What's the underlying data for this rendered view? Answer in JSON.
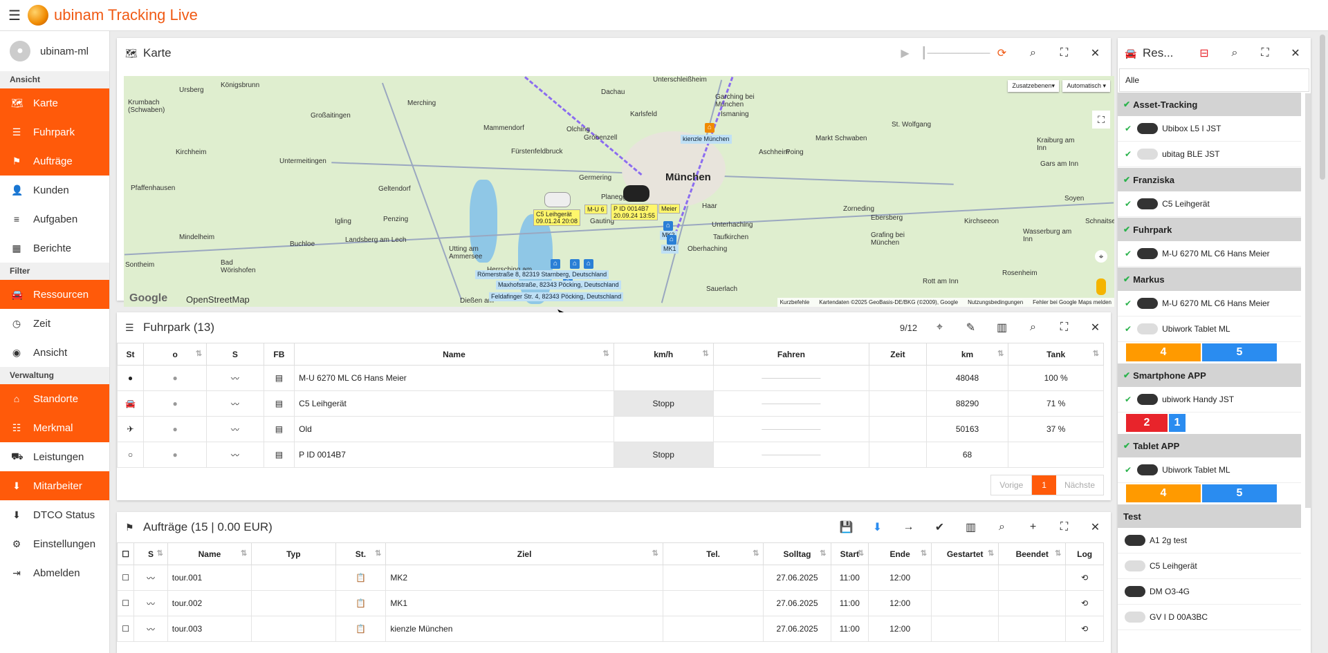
{
  "app": {
    "title": "ubinam Tracking Live"
  },
  "user": {
    "name": "ubinam-ml"
  },
  "sidebar": {
    "sections": [
      {
        "label": "Ansicht",
        "items": [
          {
            "label": "Karte",
            "icon": "map-icon",
            "active": true
          },
          {
            "label": "Fuhrpark",
            "icon": "list-icon",
            "active": true
          },
          {
            "label": "Aufträge",
            "icon": "flag-icon",
            "active": true
          },
          {
            "label": "Kunden",
            "icon": "person-icon",
            "active": false
          },
          {
            "label": "Aufgaben",
            "icon": "tasks-icon",
            "active": false
          },
          {
            "label": "Berichte",
            "icon": "table-icon",
            "active": false
          }
        ]
      },
      {
        "label": "Filter",
        "items": [
          {
            "label": "Ressourcen",
            "icon": "car-icon",
            "active": true
          },
          {
            "label": "Zeit",
            "icon": "clock-icon",
            "active": false
          },
          {
            "label": "Ansicht",
            "icon": "eye-icon",
            "active": false
          }
        ]
      },
      {
        "label": "Verwaltung",
        "items": [
          {
            "label": "Standorte",
            "icon": "home-icon",
            "active": true
          },
          {
            "label": "Merkmal",
            "icon": "sliders-icon",
            "active": true
          },
          {
            "label": "Leistungen",
            "icon": "basket-icon",
            "active": false
          },
          {
            "label": "Mitarbeiter",
            "icon": "download-icon",
            "active": true
          },
          {
            "label": "DTCO Status",
            "icon": "download-icon",
            "active": false
          },
          {
            "label": "Einstellungen",
            "icon": "gear-icon",
            "active": false
          },
          {
            "label": "Abmelden",
            "icon": "logout-icon",
            "active": false
          }
        ]
      }
    ]
  },
  "map_panel": {
    "title": "Karte",
    "layer_button": "Zusatzebenen",
    "mode_select": "Automatisch",
    "cities": [
      "München"
    ],
    "places": [
      "Königsbrunn",
      "Krumbach (Schwaben)",
      "Ursberg",
      "Großaitingen",
      "Merching",
      "Dachau",
      "Unterschleißheim",
      "Garching bei München",
      "Ismaning",
      "Mammendorf",
      "Olching",
      "Karlsfeld",
      "Gröbenzell",
      "Fürstenfeldbruck",
      "Kirchheim",
      "Untermeitingen",
      "Germering",
      "Markt Schwaben",
      "Poing",
      "Aschheim",
      "St. Wolfgang",
      "Kraiburg am Inn",
      "Gars am Inn",
      "Pfaffenhausen",
      "Geltendorf",
      "Planegg",
      "Gauting",
      "Haar",
      "Ebersberg",
      "Zorneding",
      "Unterhaching",
      "Taufkirchen",
      "Oberhaching",
      "Kirchseeon",
      "Grafing bei München",
      "Wasserburg am Inn",
      "Soyen",
      "Schnaitsee",
      "Mindelheim",
      "Landsberg am Lech",
      "Penzing",
      "Igling",
      "Utting am Ammersee",
      "Herrsching am Ammersee",
      "Buchloe",
      "Sontheim",
      "Bad Wörishofen",
      "Dießen am",
      "Sauerlach",
      "Rott am Inn",
      "Rosenheim"
    ],
    "vehicle_labels": [
      {
        "text": "C5 Leihgerät",
        "time": "09.01.24 20:08"
      },
      {
        "text": "P ID 0014B7",
        "time": "20.09.24 13:55"
      },
      {
        "text": "M-U 6"
      },
      {
        "text": "Meier"
      }
    ],
    "poi_labels": [
      "kienzle München",
      "MK2",
      "MK1",
      "Römerstraße 8, 82319 Starnberg, Deutschland",
      "Maxhofstraße, 82343 Pöcking, Deutschland",
      "Feldafinger Str. 4, 82343 Pöcking, Deutschland"
    ],
    "attribution": {
      "google": "Google",
      "osm": "OpenStreetMap",
      "links": [
        "Kurzbefehle",
        "Kartendaten ©2025 GeoBasis-DE/BKG (©2009), Google",
        "Nutzungsbedingungen",
        "Fehler bei Google Maps melden"
      ]
    }
  },
  "fleet": {
    "title": "Fuhrpark (13)",
    "counter": "9/12",
    "columns": [
      "St",
      "o",
      "S",
      "FB",
      "Name",
      "km/h",
      "Fahren",
      "Zeit",
      "km",
      "Tank"
    ],
    "rows": [
      {
        "name": "M-U 6270 ML C6 Hans Meier",
        "kmh": "",
        "km": "48048",
        "tank": "100 %"
      },
      {
        "name": "C5 Leihgerät",
        "kmh": "Stopp",
        "km": "88290",
        "tank": "71 %"
      },
      {
        "name": "Old",
        "kmh": "",
        "km": "50163",
        "tank": "37 %"
      },
      {
        "name": "P ID 0014B7",
        "kmh": "Stopp",
        "km": "68",
        "tank": ""
      }
    ],
    "pager": {
      "prev": "Vorige",
      "page": "1",
      "next": "Nächste"
    }
  },
  "orders": {
    "title": "Aufträge (15 | 0.00 EUR)",
    "columns": [
      "S",
      "Name",
      "Typ",
      "St.",
      "Ziel",
      "Tel.",
      "Solltag",
      "Start",
      "Ende",
      "Gestartet",
      "Beendet",
      "Log"
    ],
    "rows": [
      {
        "name": "tour.001",
        "ziel": "MK2",
        "solltag": "27.06.2025",
        "start": "11:00",
        "ende": "12:00"
      },
      {
        "name": "tour.002",
        "ziel": "MK1",
        "solltag": "27.06.2025",
        "start": "11:00",
        "ende": "12:00"
      },
      {
        "name": "tour.003",
        "ziel": "kienzle München",
        "solltag": "27.06.2025",
        "start": "11:00",
        "ende": "12:00"
      }
    ]
  },
  "resources": {
    "title": "Res...",
    "filter_value": "Alle",
    "groups": [
      {
        "label": "Asset-Tracking",
        "checked": true,
        "items": [
          {
            "label": "Ubibox L5 I JST"
          },
          {
            "label": "ubitag BLE JST"
          }
        ]
      },
      {
        "label": "Franziska",
        "checked": true,
        "items": [
          {
            "label": "C5 Leihgerät"
          }
        ]
      },
      {
        "label": "Fuhrpark",
        "checked": true,
        "items": [
          {
            "label": "M-U 6270 ML C6 Hans Meier"
          }
        ]
      },
      {
        "label": "Markus",
        "checked": true,
        "items": [
          {
            "label": "M-U 6270 ML C6 Hans Meier"
          },
          {
            "label": "Ubiwork Tablet ML",
            "badges": [
              "4",
              "5"
            ]
          }
        ]
      },
      {
        "label": "Smartphone APP",
        "checked": true,
        "items": [
          {
            "label": "ubiwork Handy JST",
            "badges": [
              "2",
              "1"
            ]
          }
        ]
      },
      {
        "label": "Tablet APP",
        "checked": true,
        "items": [
          {
            "label": "Ubiwork Tablet ML",
            "badges": [
              "4",
              "5"
            ]
          }
        ]
      },
      {
        "label": "Test",
        "checked": false,
        "items": [
          {
            "label": "A1 2g test"
          },
          {
            "label": "C5 Leihgerät"
          },
          {
            "label": "DM O3-4G"
          },
          {
            "label": "GV I D 00A3BC"
          }
        ]
      }
    ]
  },
  "colors": {
    "accent": "#ff5a0a",
    "badge_orange": "#ff9a00",
    "badge_blue": "#2a8cf0",
    "badge_red": "#e8242b",
    "ok_green": "#2bb24c"
  }
}
